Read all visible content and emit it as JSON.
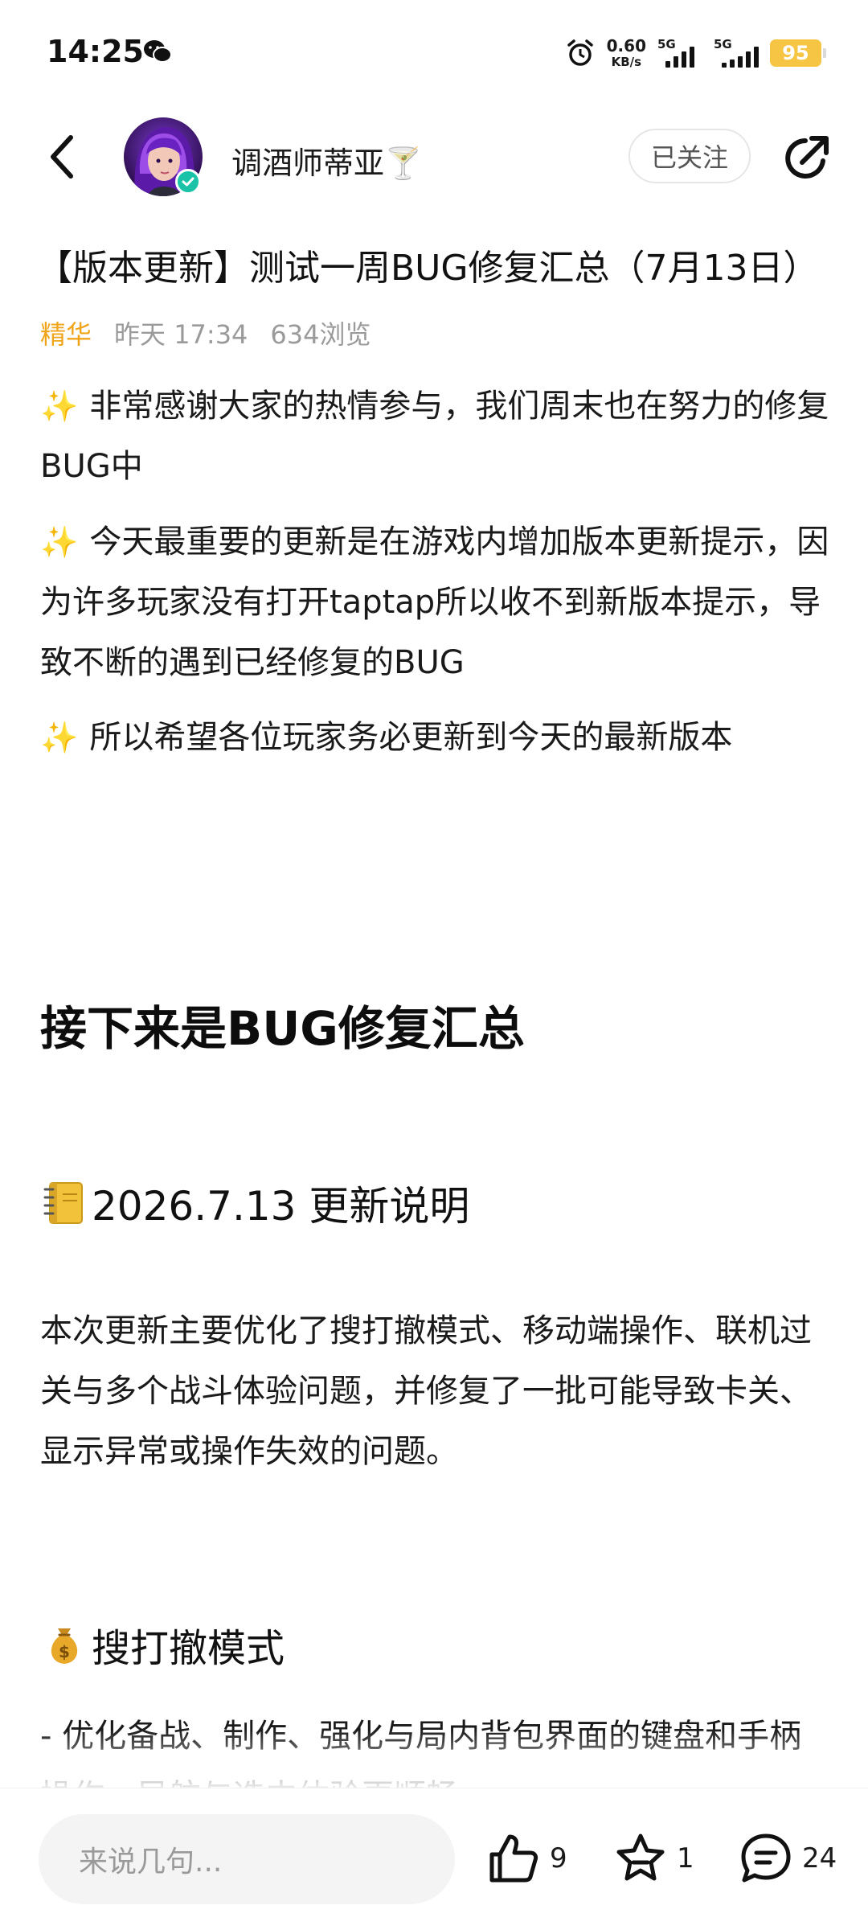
{
  "status_bar": {
    "time": "14:25",
    "net_speed_value": "0.60",
    "net_speed_unit": "KB/s",
    "sim1_tag": "5G",
    "sim2_tag": "5G",
    "battery": "95"
  },
  "header": {
    "author_name": "调酒师蒂亚🍸",
    "follow_label": "已关注"
  },
  "post": {
    "title": "【版本更新】测试一周BUG修复汇总（7月13日）",
    "tag": "精华",
    "time": "昨天 17:34",
    "views": "634浏览",
    "paragraphs": [
      "✨",
      "非常感谢大家的热情参与，我们周末也在努力的修复BUG中",
      "今天最重要的更新是在游戏内增加版本更新提示，因为许多玩家没有打开taptap所以收不到新版本提示，导致不断的遇到已经修复的BUG",
      "所以希望各位玩家务必更新到今天的最新版本"
    ],
    "section_heading": "接下来是BUG修复汇总",
    "update_heading": "2026.7.13 更新说明",
    "update_intro": "本次更新主要优化了搜打撤模式、移动端操作、联机过关与多个战斗体验问题，并修复了一批可能导致卡关、显示异常或操作失效的问题。",
    "mode_heading": "搜打撤模式",
    "mode_item": " - 优化备战、制作、强化与局内背包界面的键盘和手柄操作，导航与选中体验更顺畅。"
  },
  "bottom_bar": {
    "comment_placeholder": "来说几句...",
    "like_count": "9",
    "favorite_count": "1",
    "comment_count": "24"
  },
  "icons": {
    "back": "chevron-left-icon",
    "share": "share-icon",
    "like": "thumbs-up-icon",
    "favorite": "star-icon",
    "comment": "comment-bubble-icon",
    "notebook": "notebook-emoji",
    "money": "money-bag-emoji"
  },
  "colors": {
    "featured_tag": "#f0a41a",
    "meta_grey": "#9a9a9a",
    "battery": "#f6c544",
    "verified": "#1ac3a8"
  }
}
